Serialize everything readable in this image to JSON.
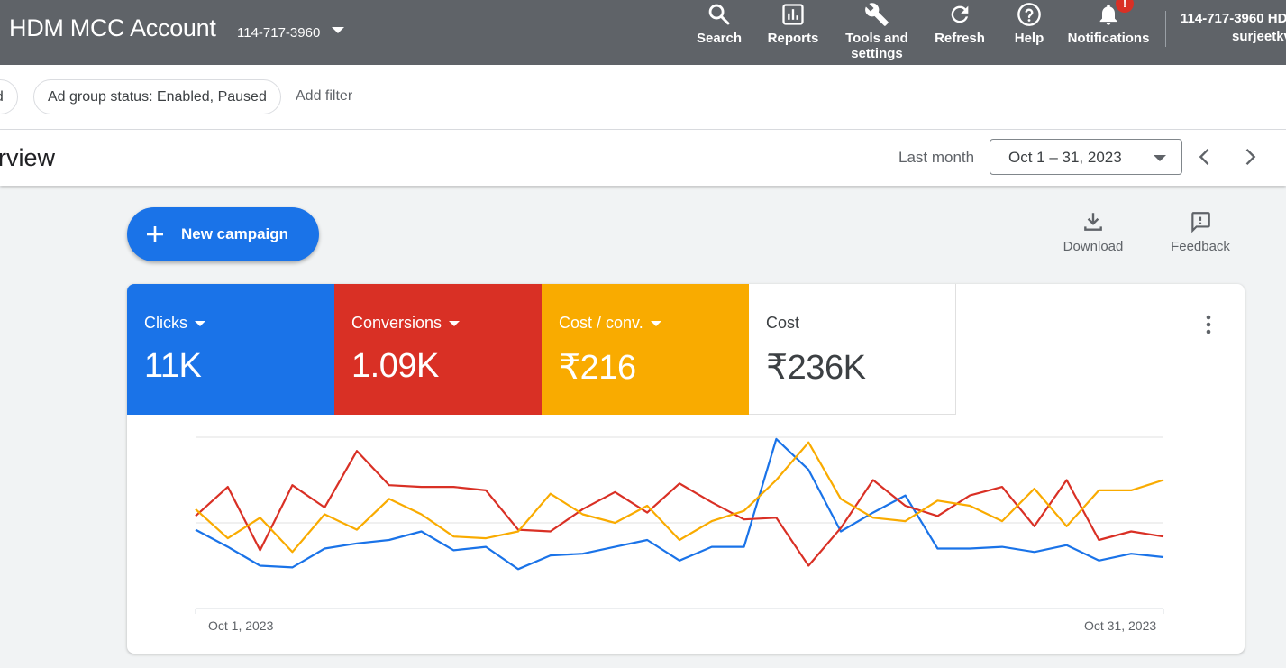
{
  "topbar": {
    "account_title": "HDM MCC Account",
    "account_id": "114-717-3960",
    "nav": {
      "search": "Search",
      "reports": "Reports",
      "tools": "Tools and settings",
      "refresh": "Refresh",
      "help": "Help",
      "notifications": "Notifications",
      "notification_badge": "!"
    },
    "user_id": "114-717-3960 HD",
    "user_name": "surjeetkv"
  },
  "filters": {
    "chip_partial": "ed",
    "chip_status": "Ad group status: Enabled, Paused",
    "add_filter": "Add filter"
  },
  "header": {
    "page_title": "rview",
    "date_range_label": "Last month",
    "date_range_value": "Oct 1 – 31, 2023"
  },
  "actions": {
    "new_campaign": "New campaign",
    "download": "Download",
    "feedback": "Feedback"
  },
  "metrics": [
    {
      "label": "Clicks",
      "value": "11K",
      "color": "#1a73e8",
      "text_color": "#ffffff",
      "has_dropdown": true
    },
    {
      "label": "Conversions",
      "value": "1.09K",
      "color": "#d93025",
      "text_color": "#ffffff",
      "has_dropdown": true
    },
    {
      "label": "Cost / conv.",
      "value": "₹216",
      "color": "#f9ab00",
      "text_color": "#ffffff",
      "has_dropdown": true
    },
    {
      "label": "Cost",
      "value": "₹236K",
      "color": "#ffffff",
      "text_color": "#3c4043",
      "has_dropdown": false
    }
  ],
  "chart_data": {
    "type": "line",
    "x_start_label": "Oct 1, 2023",
    "x_end_label": "Oct 31, 2023",
    "x": [
      1,
      2,
      3,
      4,
      5,
      6,
      7,
      8,
      9,
      10,
      11,
      12,
      13,
      14,
      15,
      16,
      17,
      18,
      19,
      20,
      21,
      22,
      23,
      24,
      25,
      26,
      27,
      28,
      29,
      30,
      31
    ],
    "normalized_scale": [
      0,
      100
    ],
    "grid": true,
    "series": [
      {
        "metric": "Clicks",
        "color": "#1a73e8",
        "values": [
          46,
          36,
          25,
          24,
          35,
          38,
          40,
          45,
          34,
          36,
          23,
          31,
          32,
          36,
          40,
          28,
          36,
          36,
          99,
          81,
          45,
          56,
          66,
          35,
          35,
          36,
          33,
          37,
          28,
          32,
          30
        ]
      },
      {
        "metric": "Conversions",
        "color": "#d93025",
        "values": [
          54,
          71,
          34,
          72,
          59,
          92,
          72,
          71,
          71,
          69,
          46,
          45,
          58,
          68,
          56,
          73,
          62,
          52,
          53,
          25,
          47,
          75,
          60,
          54,
          66,
          71,
          48,
          75,
          40,
          45,
          42
        ]
      },
      {
        "metric": "Cost / conv.",
        "color": "#f9ab00",
        "values": [
          58,
          41,
          53,
          33,
          55,
          46,
          64,
          55,
          42,
          41,
          45,
          67,
          55,
          50,
          60,
          40,
          51,
          57,
          75,
          97,
          64,
          53,
          51,
          63,
          60,
          51,
          70,
          48,
          69,
          69,
          75
        ]
      }
    ]
  }
}
